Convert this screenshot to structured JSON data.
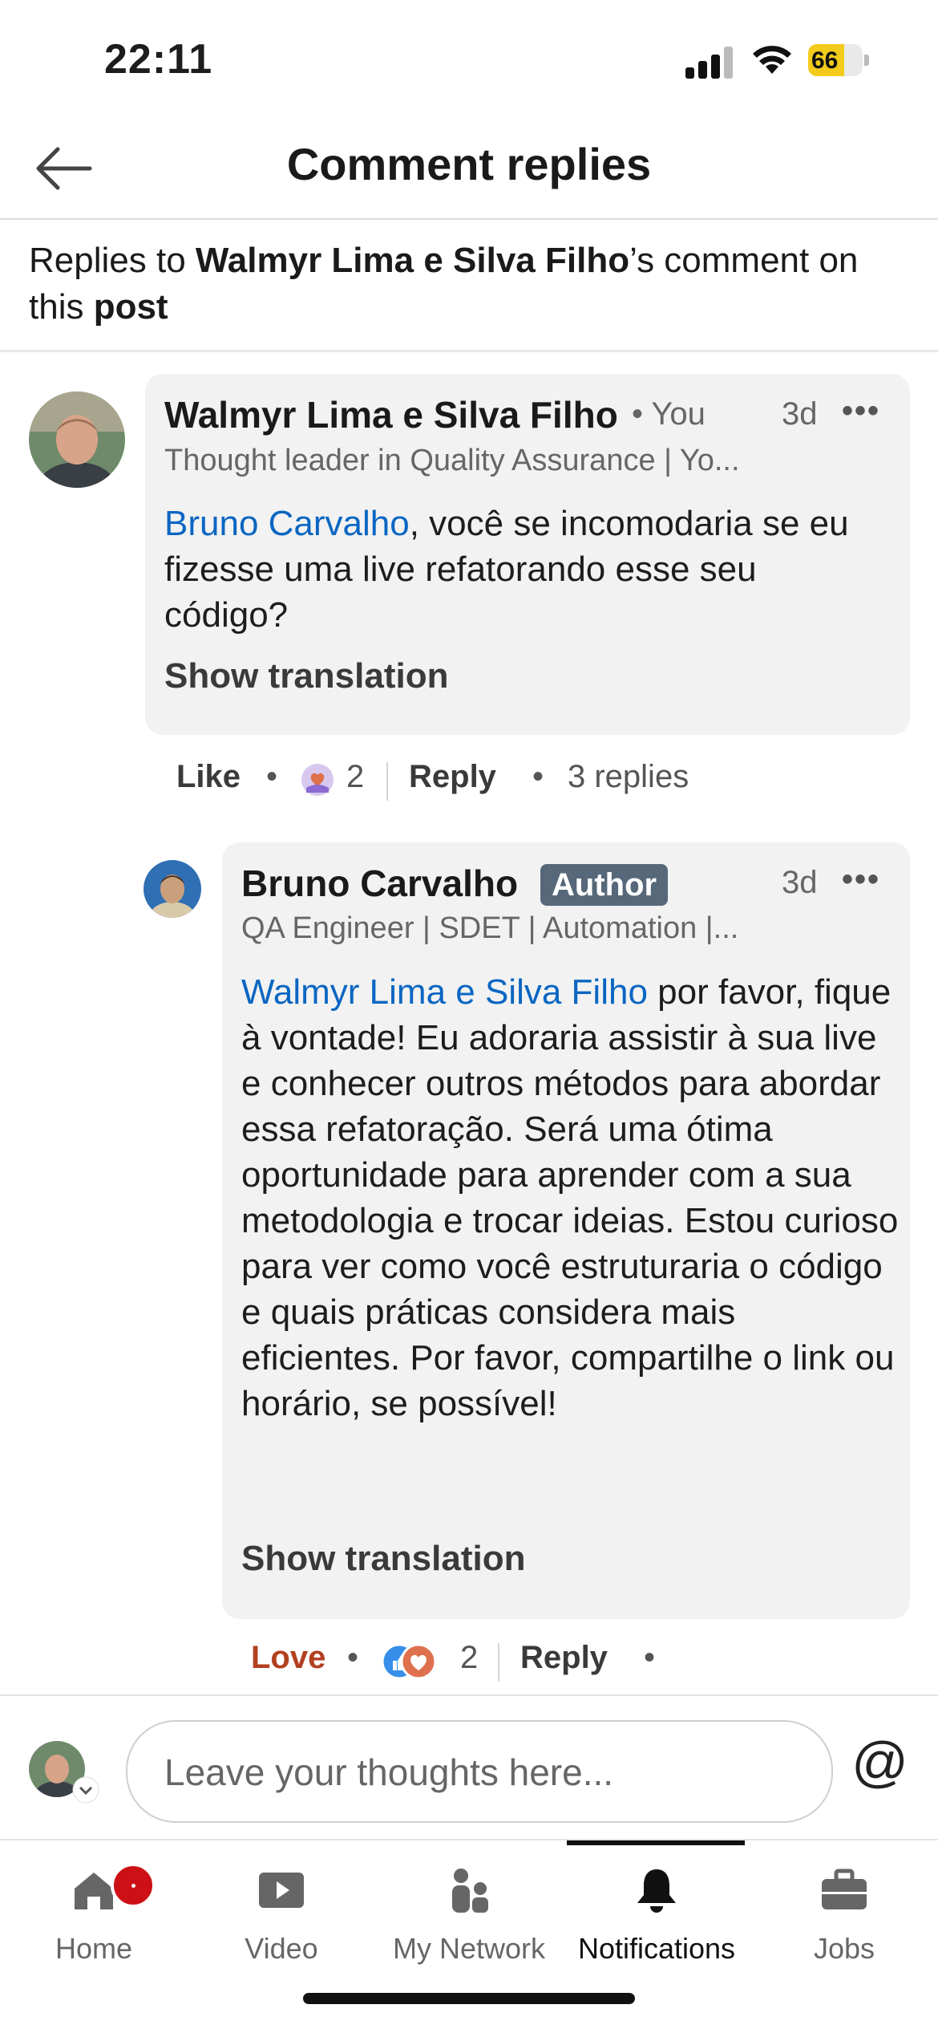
{
  "status_bar": {
    "time": "22:11",
    "battery": "66",
    "battery_level": 66
  },
  "header": {
    "title": "Comment replies"
  },
  "context": {
    "prefix": "Replies to ",
    "author": "Walmyr Lima e Silva Filho",
    "mid": "’s comment on this ",
    "post": "post"
  },
  "comment": {
    "name": "Walmyr Lima e Silva Filho",
    "you": "• You",
    "age": "3d",
    "more": "•••",
    "headline": "Thought leader in Quality Assurance | Yo...",
    "mention": "Bruno Carvalho",
    "text": ", você se incomodaria se eu fizesse uma live refatorando esse seu código?",
    "show_translation": "Show translation",
    "like": "Like",
    "reaction_count": "2",
    "reply": "Reply",
    "replies": "3 replies",
    "dot": "•"
  },
  "reply": {
    "name": "Bruno Carvalho",
    "author_badge": "Author",
    "age": "3d",
    "more": "•••",
    "headline": "QA Engineer | SDET | Automation |...",
    "mention": "Walmyr Lima e Silva Filho",
    "text": " por favor, fique à vontade! Eu adoraria assistir à sua live e conhecer outros métodos para abordar essa refatoração. Será uma ótima oportunidade para aprender com a sua metodologia e trocar ideias. Estou curioso para ver como você estruturaria o código e quais práticas considera mais eficientes. Por favor, compartilhe o link ou horário, se possível!",
    "show_translation": "Show translation",
    "love": "Love",
    "reaction_count": "2",
    "reply": "Reply",
    "dot": "•"
  },
  "composer": {
    "placeholder": "Leave your thoughts here...",
    "at": "@"
  },
  "tabs": [
    {
      "label": "Home",
      "icon": "home-icon"
    },
    {
      "label": "Video",
      "icon": "video-icon"
    },
    {
      "label": "My Network",
      "icon": "network-icon"
    },
    {
      "label": "Notifications",
      "icon": "bell-icon"
    },
    {
      "label": "Jobs",
      "icon": "briefcase-icon"
    }
  ],
  "colors": {
    "link": "#0a66c2",
    "love": "#b24020",
    "badge": "#cc1016",
    "author_badge": "#56687a"
  }
}
